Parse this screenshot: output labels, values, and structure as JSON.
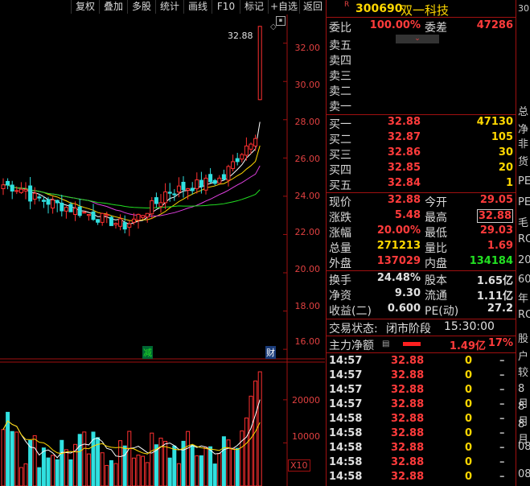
{
  "toolbar": {
    "buttons": [
      "复权",
      "叠加",
      "多股",
      "统计",
      "画线",
      "F10",
      "标记",
      "+自选",
      "返回"
    ]
  },
  "price_chart": {
    "y_ticks": [
      "32.00",
      "30.00",
      "28.00",
      "26.00",
      "24.00",
      "22.00",
      "20.00",
      "18.00",
      "16.00"
    ],
    "high_label": "32.88",
    "event_jian": "减",
    "event_cai": "财"
  },
  "volume_chart": {
    "y_ticks": [
      "20000",
      "10000"
    ],
    "unit": "X10"
  },
  "chart_data": {
    "type": "candlestick",
    "ylim": [
      15.5,
      33.5
    ],
    "last_close": 32.88,
    "ma_colors": {
      "ma5": "#ffffff",
      "ma10": "#ffd700",
      "ma20": "#e040e0",
      "ma60": "#22e022"
    },
    "volume_ylim": [
      0,
      28000
    ]
  },
  "stock": {
    "r_badge": "R",
    "code": "300690",
    "name": "双一科技",
    "side_top": "30"
  },
  "weibi": {
    "label": "委比",
    "value": "100.00%",
    "cha_label": "委差",
    "cha_value": "47286"
  },
  "sell": [
    {
      "label": "卖五",
      "price": "",
      "vol": ""
    },
    {
      "label": "卖四",
      "price": "",
      "vol": ""
    },
    {
      "label": "卖三",
      "price": "",
      "vol": ""
    },
    {
      "label": "卖二",
      "price": "",
      "vol": ""
    },
    {
      "label": "卖一",
      "price": "",
      "vol": ""
    }
  ],
  "buy": [
    {
      "label": "买一",
      "price": "32.88",
      "vol": "47130"
    },
    {
      "label": "买二",
      "price": "32.87",
      "vol": "105"
    },
    {
      "label": "买三",
      "price": "32.86",
      "vol": "30"
    },
    {
      "label": "买四",
      "price": "32.85",
      "vol": "20"
    },
    {
      "label": "买五",
      "price": "32.84",
      "vol": "1"
    }
  ],
  "quote": {
    "xianjia_l": "现价",
    "xianjia": "32.88",
    "jinkai_l": "今开",
    "jinkai": "29.05",
    "zhangdie_l": "涨跌",
    "zhangdie": "5.48",
    "zuigao_l": "最高",
    "zuigao": "32.88",
    "zhangfu_l": "涨幅",
    "zhangfu": "20.00%",
    "zuidi_l": "最低",
    "zuidi": "29.03",
    "zongliang_l": "总量",
    "zongliang": "271213",
    "liangbi_l": "量比",
    "liangbi": "1.69",
    "waipan_l": "外盘",
    "waipan": "137029",
    "neipan_l": "内盘",
    "neipan": "134184",
    "huanshou_l": "换手",
    "huanshou": "24.48%",
    "guben_l": "股本",
    "guben": "1.65亿",
    "jingzi_l": "净资",
    "jingzi": "9.30",
    "liutong_l": "流通",
    "liutong": "1.11亿",
    "shouyi_l": "收益(二)",
    "shouyi": "0.600",
    "pe_l": "PE(动)",
    "pe": "27.2"
  },
  "status": {
    "label": "交易状态:",
    "state": "闭市阶段",
    "time": "15:30:00"
  },
  "zhuli": {
    "label": "主力净额",
    "value": "1.49亿",
    "pct": "17%"
  },
  "ticks": [
    {
      "time": "14:57",
      "price": "32.88",
      "vol": "0"
    },
    {
      "time": "14:57",
      "price": "32.88",
      "vol": "0"
    },
    {
      "time": "14:57",
      "price": "32.88",
      "vol": "0"
    },
    {
      "time": "14:57",
      "price": "32.88",
      "vol": "0"
    },
    {
      "time": "14:58",
      "price": "32.88",
      "vol": "0"
    },
    {
      "time": "14:58",
      "price": "32.88",
      "vol": "0"
    },
    {
      "time": "14:58",
      "price": "32.88",
      "vol": "0"
    },
    {
      "time": "14:58",
      "price": "32.88",
      "vol": "0"
    },
    {
      "time": "14:58",
      "price": "32.88",
      "vol": "0"
    }
  ],
  "far_right": [
    "总",
    "净",
    "非",
    "货",
    "PE",
    "PE",
    "毛",
    "RO",
    "20",
    "60",
    "年",
    "RO",
    "股",
    "户",
    "较",
    "8月",
    "8月",
    "8月",
    "08",
    "08"
  ]
}
